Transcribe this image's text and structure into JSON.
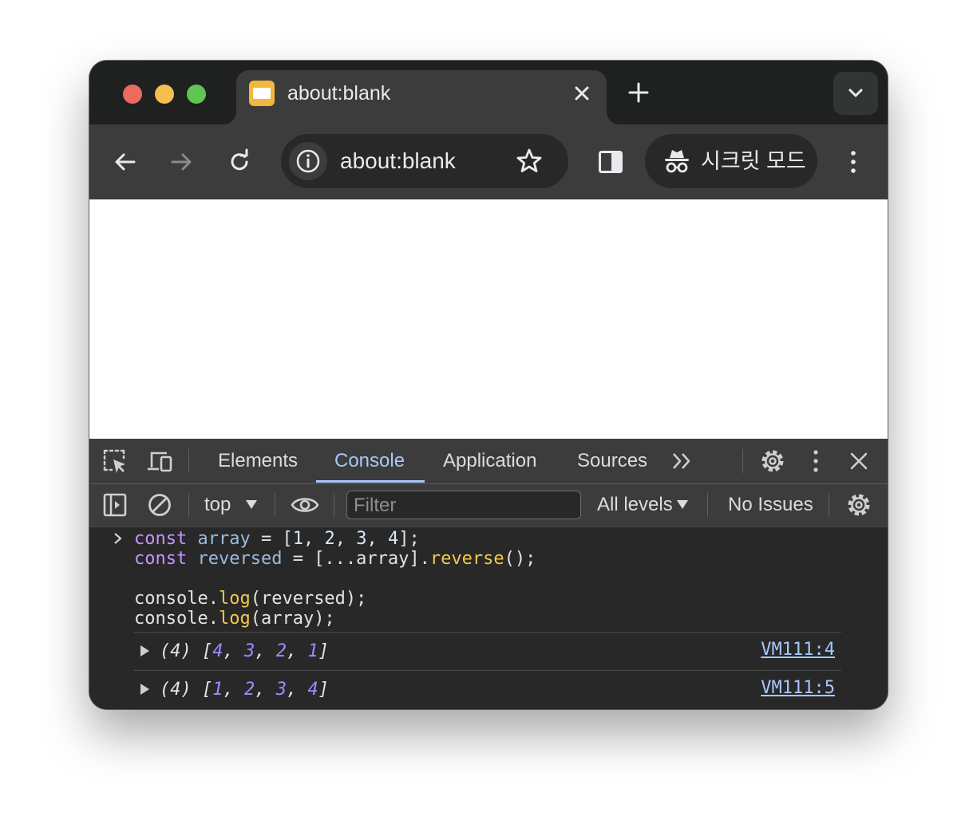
{
  "tab": {
    "title": "about:blank"
  },
  "omnibox": {
    "url": "about:blank"
  },
  "incognito": {
    "label": "시크릿 모드"
  },
  "devtools": {
    "tabs": [
      "Elements",
      "Console",
      "Application",
      "Sources"
    ],
    "active_tab": "Console",
    "context": "top",
    "filter_placeholder": "Filter",
    "levels": "All levels",
    "issues": "No Issues"
  },
  "console": {
    "code_lines": [
      "const array = [1, 2, 3, 4];",
      "const reversed = [...array].reverse();",
      "",
      "console.log(reversed);",
      "console.log(array);"
    ],
    "logs": [
      {
        "count": "(4)",
        "values": [
          "4",
          "3",
          "2",
          "1"
        ],
        "source": "VM111:4"
      },
      {
        "count": "(4)",
        "values": [
          "1",
          "2",
          "3",
          "4"
        ],
        "source": "VM111:5"
      }
    ]
  },
  "colors": {
    "window_bg": "#1f2020",
    "toolbar_bg": "#3c3c3c",
    "devtools_bg": "#282828",
    "accent": "#a8c7fa",
    "keyword": "#c694ff",
    "function": "#f2c94c",
    "number_output": "#9a8cff"
  }
}
